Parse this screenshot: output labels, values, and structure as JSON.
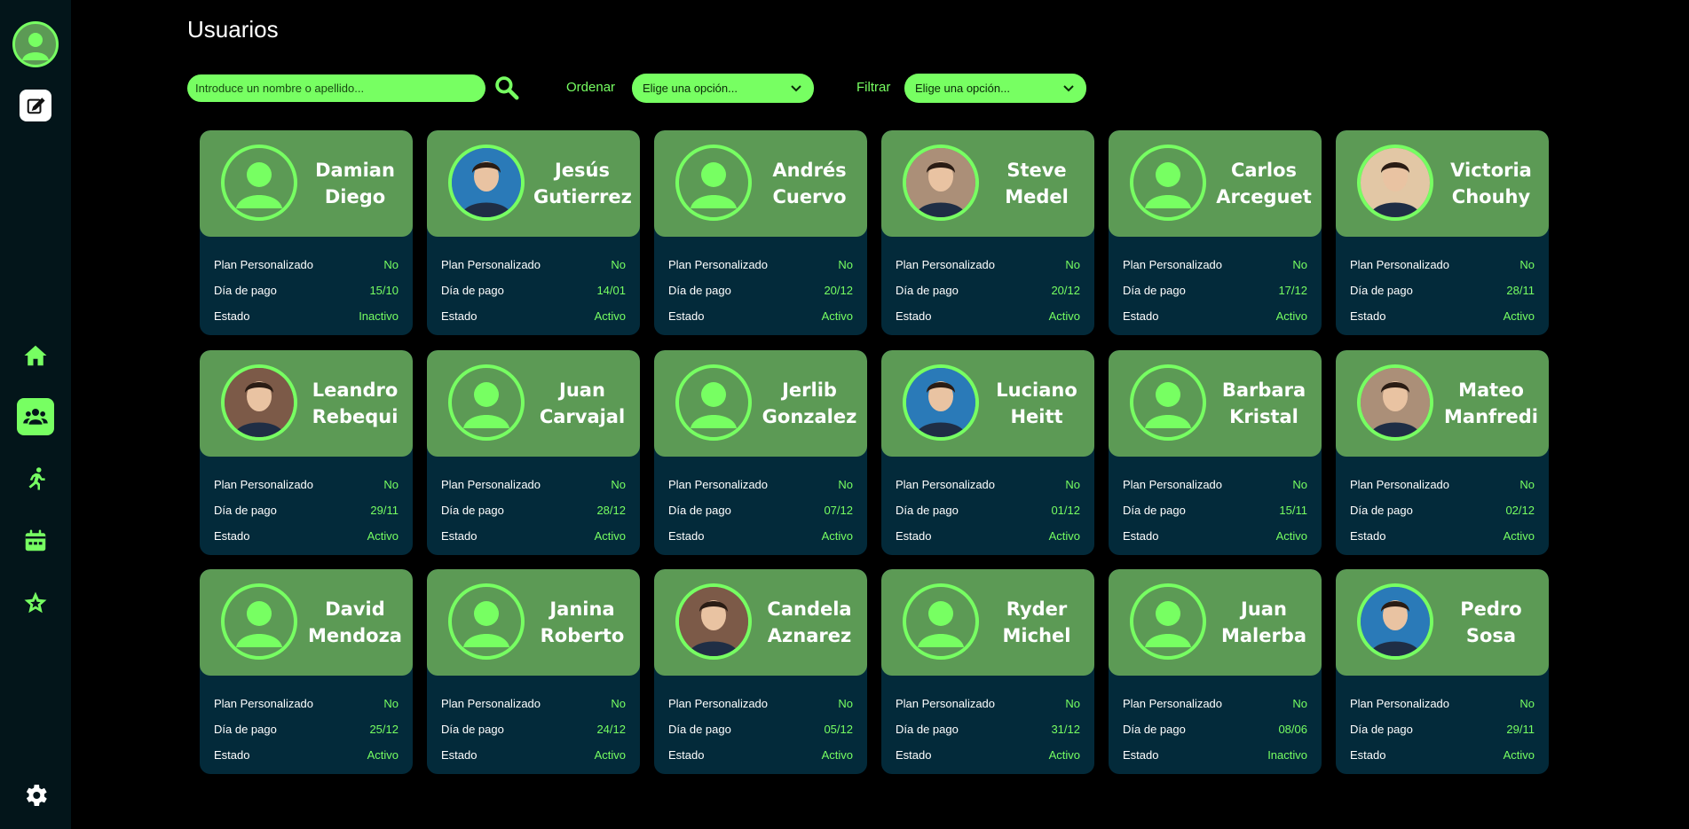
{
  "page": {
    "title": "Usuarios"
  },
  "search": {
    "placeholder": "Introduce un nombre o apellido..."
  },
  "order": {
    "label": "Ordenar",
    "value": "Elige una opción..."
  },
  "filter": {
    "label": "Filtrar",
    "value": "Elige una opción..."
  },
  "card_labels": {
    "plan": "Plan Personalizado",
    "payday": "Día de pago",
    "status": "Estado"
  },
  "sidebar": {
    "icons": [
      "user-avatar-icon",
      "edit-icon",
      "home-icon",
      "users-icon",
      "running-icon",
      "calendar-icon",
      "star-icon",
      "gear-icon"
    ],
    "active": "users-icon"
  },
  "colors": {
    "accent": "#77ff62",
    "card_top": "#5c9a55",
    "card_bottom": "#032a3a",
    "sidebar": "#03151a",
    "background": "#000000"
  },
  "users": [
    {
      "first": "Damian",
      "last": "Diego",
      "plan": "No",
      "payday": "15/10",
      "status": "Inactivo",
      "photo": "placeholder"
    },
    {
      "first": "Jesús",
      "last": "Gutierrez",
      "plan": "No",
      "payday": "14/01",
      "status": "Activo",
      "photo": "photo"
    },
    {
      "first": "Andrés",
      "last": "Cuervo",
      "plan": "No",
      "payday": "20/12",
      "status": "Activo",
      "photo": "placeholder"
    },
    {
      "first": "Steve",
      "last": "Medel",
      "plan": "No",
      "payday": "20/12",
      "status": "Activo",
      "photo": "photo"
    },
    {
      "first": "Carlos",
      "last": "Arceguet",
      "plan": "No",
      "payday": "17/12",
      "status": "Activo",
      "photo": "placeholder"
    },
    {
      "first": "Victoria",
      "last": "Chouhy",
      "plan": "No",
      "payday": "28/11",
      "status": "Activo",
      "photo": "photo"
    },
    {
      "first": "Leandro",
      "last": "Rebequi",
      "plan": "No",
      "payday": "29/11",
      "status": "Activo",
      "photo": "photo"
    },
    {
      "first": "Juan",
      "last": "Carvajal",
      "plan": "No",
      "payday": "28/12",
      "status": "Activo",
      "photo": "placeholder"
    },
    {
      "first": "Jerlib",
      "last": "Gonzalez",
      "plan": "No",
      "payday": "07/12",
      "status": "Activo",
      "photo": "placeholder"
    },
    {
      "first": "Luciano",
      "last": "Heitt",
      "plan": "No",
      "payday": "01/12",
      "status": "Activo",
      "photo": "photo"
    },
    {
      "first": "Barbara",
      "last": "Kristal",
      "plan": "No",
      "payday": "15/11",
      "status": "Activo",
      "photo": "placeholder"
    },
    {
      "first": "Mateo",
      "last": "Manfredi",
      "plan": "No",
      "payday": "02/12",
      "status": "Activo",
      "photo": "photo"
    },
    {
      "first": "David",
      "last": "Mendoza",
      "plan": "No",
      "payday": "25/12",
      "status": "Activo",
      "photo": "placeholder"
    },
    {
      "first": "Janina",
      "last": "Roberto",
      "plan": "No",
      "payday": "24/12",
      "status": "Activo",
      "photo": "placeholder"
    },
    {
      "first": "Candela",
      "last": "Aznarez",
      "plan": "No",
      "payday": "05/12",
      "status": "Activo",
      "photo": "photo"
    },
    {
      "first": "Ryder",
      "last": "Michel",
      "plan": "No",
      "payday": "31/12",
      "status": "Activo",
      "photo": "placeholder"
    },
    {
      "first": "Juan",
      "last": "Malerba",
      "plan": "No",
      "payday": "08/06",
      "status": "Inactivo",
      "photo": "placeholder"
    },
    {
      "first": "Pedro",
      "last": "Sosa",
      "plan": "No",
      "payday": "29/11",
      "status": "Activo",
      "photo": "photo"
    }
  ]
}
